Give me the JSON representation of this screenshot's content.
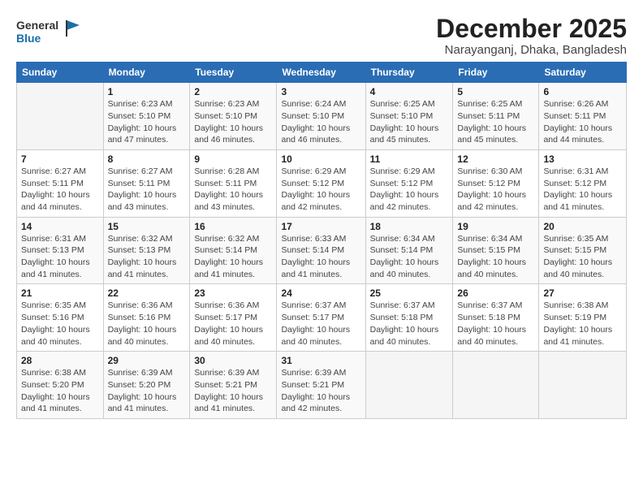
{
  "logo": {
    "line1": "General",
    "line2": "Blue"
  },
  "title": "December 2025",
  "location": "Narayanganj, Dhaka, Bangladesh",
  "header_days": [
    "Sunday",
    "Monday",
    "Tuesday",
    "Wednesday",
    "Thursday",
    "Friday",
    "Saturday"
  ],
  "weeks": [
    [
      {
        "num": "",
        "info": ""
      },
      {
        "num": "1",
        "info": "Sunrise: 6:23 AM\nSunset: 5:10 PM\nDaylight: 10 hours\nand 47 minutes."
      },
      {
        "num": "2",
        "info": "Sunrise: 6:23 AM\nSunset: 5:10 PM\nDaylight: 10 hours\nand 46 minutes."
      },
      {
        "num": "3",
        "info": "Sunrise: 6:24 AM\nSunset: 5:10 PM\nDaylight: 10 hours\nand 46 minutes."
      },
      {
        "num": "4",
        "info": "Sunrise: 6:25 AM\nSunset: 5:10 PM\nDaylight: 10 hours\nand 45 minutes."
      },
      {
        "num": "5",
        "info": "Sunrise: 6:25 AM\nSunset: 5:11 PM\nDaylight: 10 hours\nand 45 minutes."
      },
      {
        "num": "6",
        "info": "Sunrise: 6:26 AM\nSunset: 5:11 PM\nDaylight: 10 hours\nand 44 minutes."
      }
    ],
    [
      {
        "num": "7",
        "info": "Sunrise: 6:27 AM\nSunset: 5:11 PM\nDaylight: 10 hours\nand 44 minutes."
      },
      {
        "num": "8",
        "info": "Sunrise: 6:27 AM\nSunset: 5:11 PM\nDaylight: 10 hours\nand 43 minutes."
      },
      {
        "num": "9",
        "info": "Sunrise: 6:28 AM\nSunset: 5:11 PM\nDaylight: 10 hours\nand 43 minutes."
      },
      {
        "num": "10",
        "info": "Sunrise: 6:29 AM\nSunset: 5:12 PM\nDaylight: 10 hours\nand 42 minutes."
      },
      {
        "num": "11",
        "info": "Sunrise: 6:29 AM\nSunset: 5:12 PM\nDaylight: 10 hours\nand 42 minutes."
      },
      {
        "num": "12",
        "info": "Sunrise: 6:30 AM\nSunset: 5:12 PM\nDaylight: 10 hours\nand 42 minutes."
      },
      {
        "num": "13",
        "info": "Sunrise: 6:31 AM\nSunset: 5:12 PM\nDaylight: 10 hours\nand 41 minutes."
      }
    ],
    [
      {
        "num": "14",
        "info": "Sunrise: 6:31 AM\nSunset: 5:13 PM\nDaylight: 10 hours\nand 41 minutes."
      },
      {
        "num": "15",
        "info": "Sunrise: 6:32 AM\nSunset: 5:13 PM\nDaylight: 10 hours\nand 41 minutes."
      },
      {
        "num": "16",
        "info": "Sunrise: 6:32 AM\nSunset: 5:14 PM\nDaylight: 10 hours\nand 41 minutes."
      },
      {
        "num": "17",
        "info": "Sunrise: 6:33 AM\nSunset: 5:14 PM\nDaylight: 10 hours\nand 41 minutes."
      },
      {
        "num": "18",
        "info": "Sunrise: 6:34 AM\nSunset: 5:14 PM\nDaylight: 10 hours\nand 40 minutes."
      },
      {
        "num": "19",
        "info": "Sunrise: 6:34 AM\nSunset: 5:15 PM\nDaylight: 10 hours\nand 40 minutes."
      },
      {
        "num": "20",
        "info": "Sunrise: 6:35 AM\nSunset: 5:15 PM\nDaylight: 10 hours\nand 40 minutes."
      }
    ],
    [
      {
        "num": "21",
        "info": "Sunrise: 6:35 AM\nSunset: 5:16 PM\nDaylight: 10 hours\nand 40 minutes."
      },
      {
        "num": "22",
        "info": "Sunrise: 6:36 AM\nSunset: 5:16 PM\nDaylight: 10 hours\nand 40 minutes."
      },
      {
        "num": "23",
        "info": "Sunrise: 6:36 AM\nSunset: 5:17 PM\nDaylight: 10 hours\nand 40 minutes."
      },
      {
        "num": "24",
        "info": "Sunrise: 6:37 AM\nSunset: 5:17 PM\nDaylight: 10 hours\nand 40 minutes."
      },
      {
        "num": "25",
        "info": "Sunrise: 6:37 AM\nSunset: 5:18 PM\nDaylight: 10 hours\nand 40 minutes."
      },
      {
        "num": "26",
        "info": "Sunrise: 6:37 AM\nSunset: 5:18 PM\nDaylight: 10 hours\nand 40 minutes."
      },
      {
        "num": "27",
        "info": "Sunrise: 6:38 AM\nSunset: 5:19 PM\nDaylight: 10 hours\nand 41 minutes."
      }
    ],
    [
      {
        "num": "28",
        "info": "Sunrise: 6:38 AM\nSunset: 5:20 PM\nDaylight: 10 hours\nand 41 minutes."
      },
      {
        "num": "29",
        "info": "Sunrise: 6:39 AM\nSunset: 5:20 PM\nDaylight: 10 hours\nand 41 minutes."
      },
      {
        "num": "30",
        "info": "Sunrise: 6:39 AM\nSunset: 5:21 PM\nDaylight: 10 hours\nand 41 minutes."
      },
      {
        "num": "31",
        "info": "Sunrise: 6:39 AM\nSunset: 5:21 PM\nDaylight: 10 hours\nand 42 minutes."
      },
      {
        "num": "",
        "info": ""
      },
      {
        "num": "",
        "info": ""
      },
      {
        "num": "",
        "info": ""
      }
    ]
  ]
}
